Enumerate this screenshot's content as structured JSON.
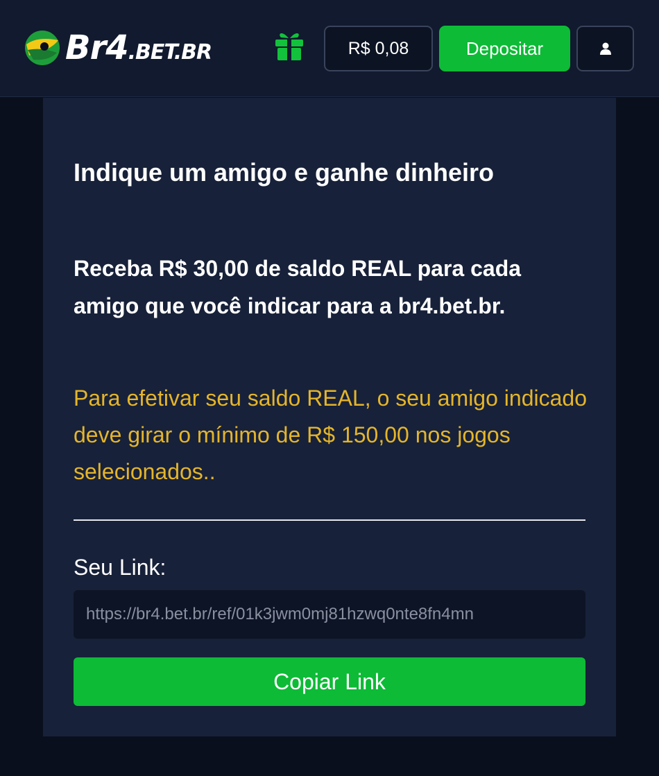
{
  "header": {
    "logo": {
      "big_text": "Br4",
      "small_text": ".BET.BR"
    },
    "gift_icon": "gift-icon",
    "balance": "R$ 0,08",
    "deposit_label": "Depositar",
    "user_icon": "user-icon"
  },
  "main": {
    "title": "Indique um amigo e ganhe dinheiro",
    "subtitle": "Receba R$ 30,00 de saldo REAL para cada amigo que você indicar para a br4.bet.br.",
    "note": "Para efetivar seu saldo REAL, o seu amigo indicado deve girar o mínimo de R$ 150,00 nos jogos selecionados..",
    "link_label": "Seu Link:",
    "link_value": "https://br4.bet.br/ref/01k3jwm0mj81hzwq0nte8fn4mn",
    "copy_label": "Copiar Link"
  },
  "colors": {
    "header_bg": "#111a2e",
    "card_bg": "#172139",
    "accent_green": "#0dbb36",
    "note_yellow": "#e5b52a"
  }
}
